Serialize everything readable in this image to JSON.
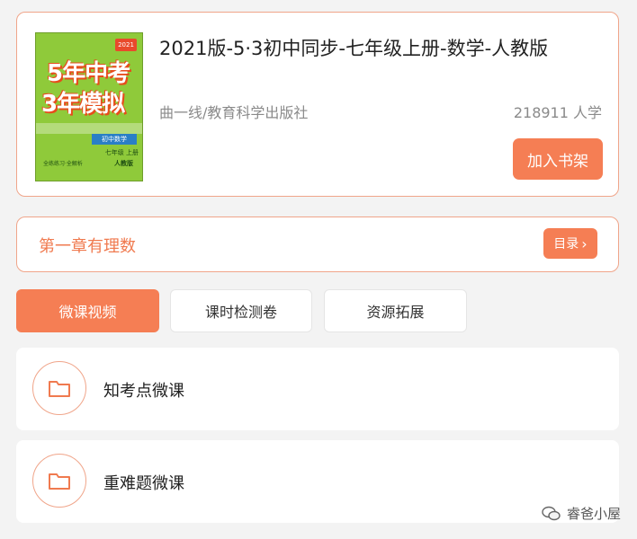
{
  "book": {
    "title": "2021版-5·3初中同步-七年级上册-数学-人教版",
    "publisher": "曲一线/教育科学出版社",
    "learners": "218911 人学",
    "add_button": "加入书架",
    "cover": {
      "line1": "5年中考",
      "line2": "3年模拟",
      "badge": "2021",
      "subject": "初中数学",
      "grade": "七年级 上册",
      "edition": "人教版",
      "small": "全练练习·全解析"
    }
  },
  "chapter": {
    "title": "第一章有理数",
    "toc_button": "目录",
    "toc_chevron": "›"
  },
  "tabs": [
    {
      "label": "微课视频",
      "active": true
    },
    {
      "label": "课时检测卷",
      "active": false
    },
    {
      "label": "资源拓展",
      "active": false
    }
  ],
  "resources": [
    {
      "label": "知考点微课",
      "icon": "folder-icon"
    },
    {
      "label": "重难题微课",
      "icon": "folder-icon"
    }
  ],
  "watermark": {
    "text": "睿爸小屋",
    "icon": "wechat-icon"
  },
  "colors": {
    "accent": "#f57e54",
    "accent_border": "#f0a58a",
    "chapter_text": "#f07a4f"
  }
}
